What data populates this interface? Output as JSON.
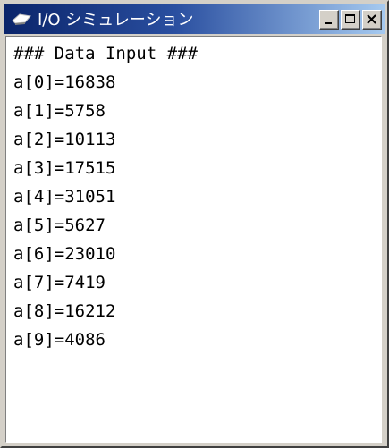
{
  "window": {
    "title": "I/O シミュレーション",
    "icon": "io-device-icon",
    "buttons": [
      "minimize",
      "maximize",
      "close"
    ]
  },
  "console": {
    "header": "### Data Input ###",
    "lines": [
      "a[0]=16838",
      "a[1]=5758",
      "a[2]=10113",
      "a[3]=17515",
      "a[4]=31051",
      "a[5]=5627",
      "a[6]=23010",
      "a[7]=7419",
      "a[8]=16212",
      "a[9]=4086"
    ]
  },
  "colors": {
    "title_active_start": "#0a246a",
    "title_active_end": "#a6caf0",
    "chrome": "#d4d0c8",
    "text": "#000000",
    "console_bg": "#ffffff"
  }
}
